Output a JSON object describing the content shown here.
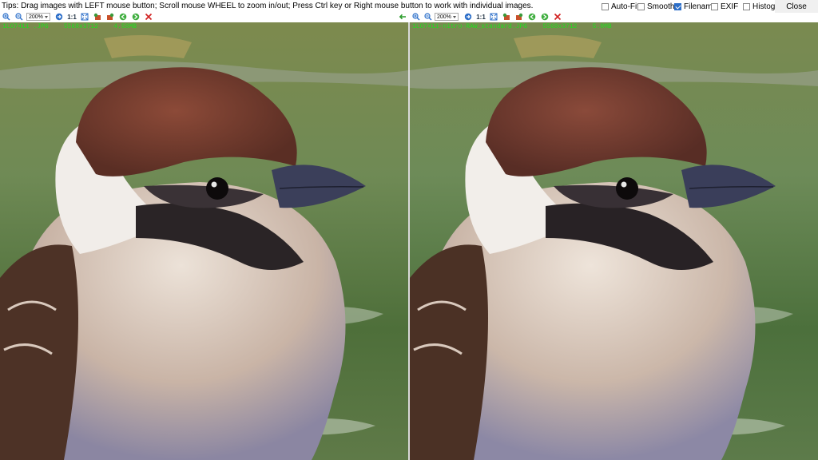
{
  "tips": "Tips: Drag images with LEFT mouse button; Scroll mouse WHEEL to zoom in/out; Press Ctrl key or Right mouse button to work with individual images.",
  "options": [
    {
      "label": "Auto-Fit",
      "checked": false
    },
    {
      "label": "Smooth",
      "checked": false
    },
    {
      "label": "Filename",
      "checked": true
    },
    {
      "label": "EXIF",
      "checked": false
    },
    {
      "label": "Histogram",
      "checked": false
    }
  ],
  "close_label": "Close",
  "left_toolbar": {
    "icons": [
      "zoom-in-icon",
      "zoom-out-icon",
      "zoom-level-select",
      "fit-arrow-icon",
      "one-to-one-icon",
      "fit-window-icon",
      "rotate-left-icon",
      "rotate-right-icon",
      "previous-image-icon",
      "next-image-icon",
      "close-image-icon"
    ],
    "zoom": "200%",
    "one_to_one": "1:1"
  },
  "right_toolbar": {
    "zoom": "200%",
    "one_to_one": "1:1"
  },
  "left_image": {
    "filename": "1LO7411 .JPG",
    "dimensions": "5568x3712",
    "size": "4.58MB"
  },
  "right_image": {
    "filename": "1LO7411-nitro-RAW_standard.JPG",
    "dimensions": "5568x3712",
    "size": "5.0MB"
  },
  "colors": {
    "accent": "#2d6fc9",
    "info_text": "#1ee01e",
    "close_icon": "#d11f1f",
    "arrow_icon": "#2a9c2a"
  }
}
